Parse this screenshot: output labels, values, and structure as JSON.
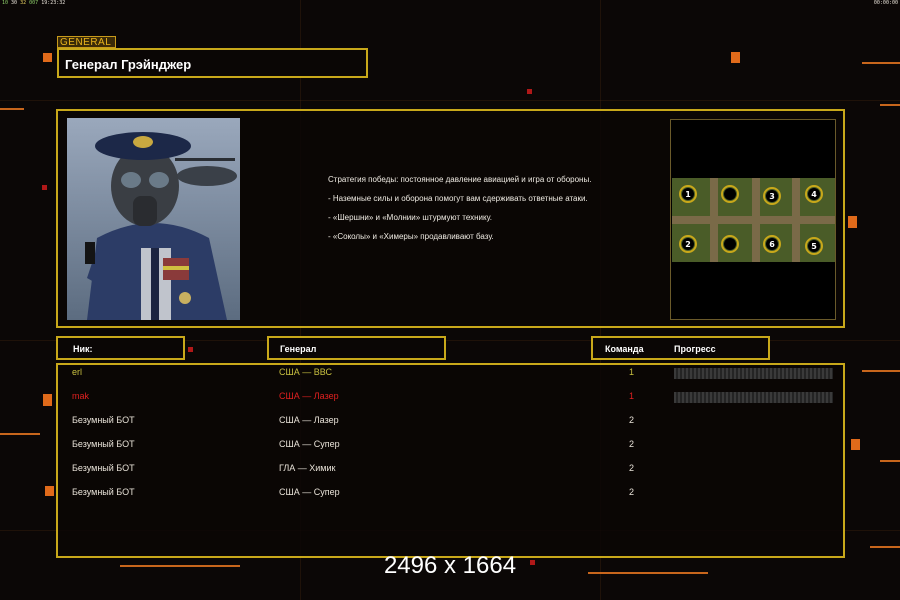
{
  "status_bar": {
    "left_values": [
      "10",
      "30",
      "32",
      "007",
      "19:23:32"
    ],
    "right_value": "00:00:00"
  },
  "general_tag": "GENERAL",
  "general_name": "Генерал Грэйнджер",
  "description": [
    "Стратегия победы: постоянное давление авиацией и игра от обороны.",
    "- Наземные силы и оборона помогут вам сдерживать ответные атаки.",
    "- «Шершни» и «Молнии» штурмуют технику.",
    "- «Соколы» и «Химеры» продавливают базу."
  ],
  "minimap": {
    "start_positions": [
      "1",
      "3",
      "4",
      "2",
      "6",
      "5"
    ]
  },
  "headers": {
    "nick": "Ник:",
    "general": "Генерал",
    "team": "Команда",
    "progress": "Прогресс"
  },
  "players": [
    {
      "nick": "erl",
      "general": "США — ВВС",
      "team": "1",
      "color": "#c8c040",
      "progress": 0.0
    },
    {
      "nick": "mak",
      "general": "США — Лазер",
      "team": "1",
      "color": "#e02020",
      "progress": 0.0
    },
    {
      "nick": "Безумный БОТ",
      "general": "США — Лазер",
      "team": "2",
      "color": "#f0ece4"
    },
    {
      "nick": "Безумный БОТ",
      "general": "США — Супер",
      "team": "2",
      "color": "#f0ece4"
    },
    {
      "nick": "Безумный БОТ",
      "general": "ГЛА — Химик",
      "team": "2",
      "color": "#f0ece4"
    },
    {
      "nick": "Безумный БОТ",
      "general": "США — Супер",
      "team": "2",
      "color": "#f0ece4"
    }
  ],
  "watermark": "2496 x 1664",
  "colors": {
    "frame": "#c8a81a",
    "accent_orange": "#e06a1a",
    "background": "#0b0706"
  }
}
